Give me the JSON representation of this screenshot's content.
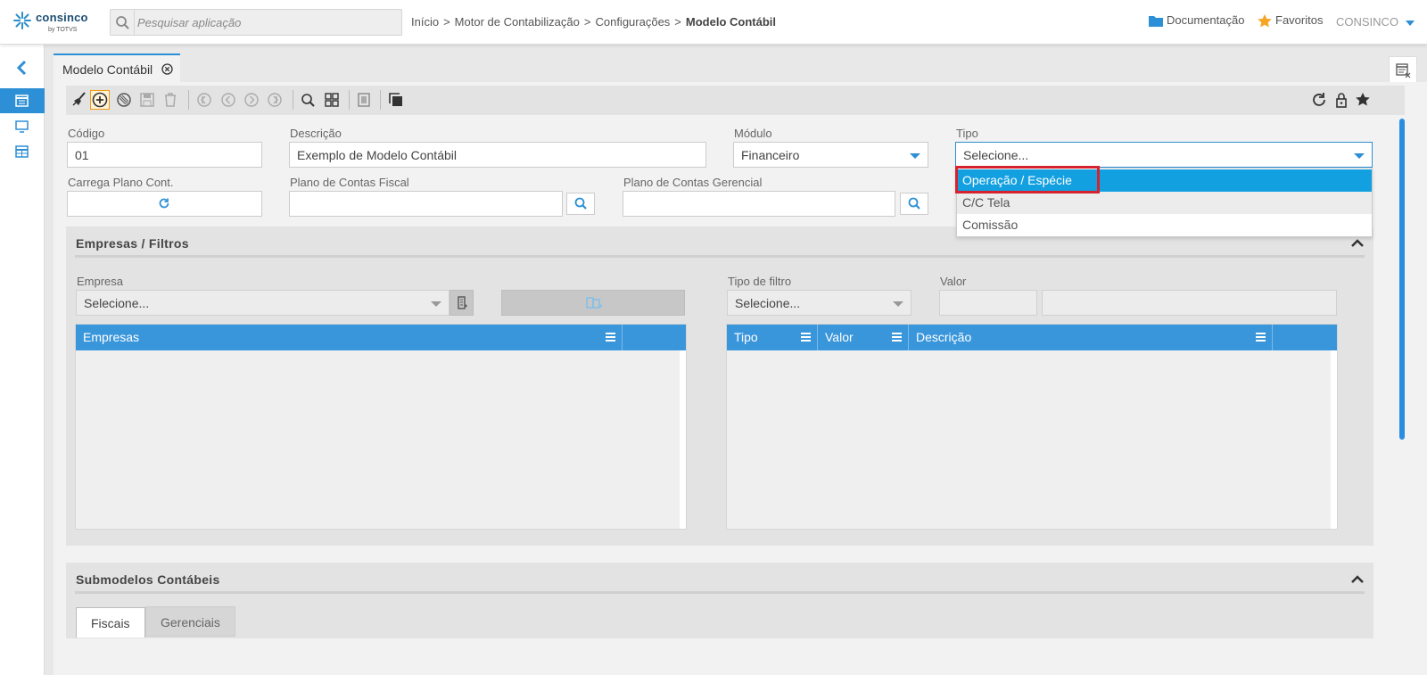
{
  "brand": {
    "name": "consinco",
    "by": "by TOTVS"
  },
  "search": {
    "placeholder": "Pesquisar aplicação"
  },
  "breadcrumb": {
    "items": [
      "Início",
      "Motor de Contabilização",
      "Configurações"
    ],
    "separator": ">",
    "current": "Modelo Contábil"
  },
  "header_links": {
    "documentation": "Documentação",
    "favorites": "Favoritos",
    "user": "CONSINCO"
  },
  "tab": {
    "title": "Modelo Contábil"
  },
  "form": {
    "codigo_label": "Código",
    "codigo_value": "01",
    "descricao_label": "Descrição",
    "descricao_value": "Exemplo de Modelo Contábil",
    "modulo_label": "Módulo",
    "modulo_value": "Financeiro",
    "tipo_label": "Tipo",
    "tipo_value": "Selecione...",
    "carrega_label": "Carrega Plano Cont.",
    "plano_fiscal_label": "Plano de Contas Fiscal",
    "plano_gerencial_label": "Plano de Contas Gerencial"
  },
  "tipo_dropdown": {
    "options": [
      "Operação / Espécie",
      "C/C Tela",
      "Comissão"
    ],
    "highlighted": "Operação / Espécie"
  },
  "empresas_panel": {
    "title": "Empresas / Filtros",
    "empresa_label": "Empresa",
    "empresa_value": "Selecione...",
    "tipo_filtro_label": "Tipo de filtro",
    "tipo_filtro_value": "Selecione...",
    "valor_label": "Valor",
    "empresas_grid_columns": [
      "Empresas"
    ],
    "filtros_grid_columns": [
      "Tipo",
      "Valor",
      "Descrição"
    ]
  },
  "submodelos_panel": {
    "title": "Submodelos Contábeis",
    "tabs": [
      "Fiscais",
      "Gerenciais"
    ]
  },
  "colors": {
    "accent": "#2d8fd5",
    "grid_header": "#3a96db",
    "highlight": "#12a0e0",
    "callout": "#d6222f"
  }
}
